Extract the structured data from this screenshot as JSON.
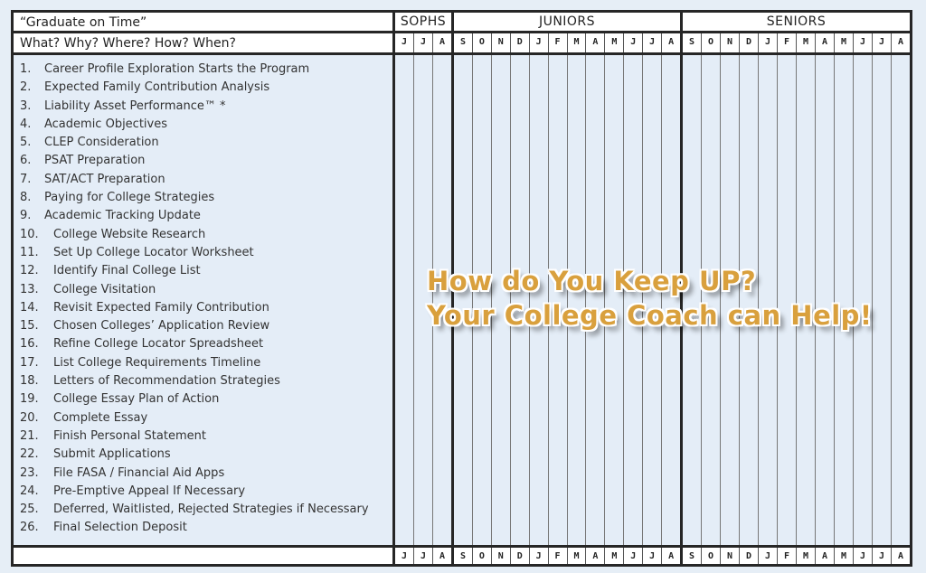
{
  "header": {
    "title": "“Graduate on Time”",
    "subtitle": "What? Why? Where? How? When?"
  },
  "sections": [
    {
      "label": "SOPHS",
      "months": [
        "J",
        "J",
        "A"
      ]
    },
    {
      "label": "JUNIORS",
      "months": [
        "S",
        "O",
        "N",
        "D",
        "J",
        "F",
        "M",
        "A",
        "M",
        "J",
        "J",
        "A"
      ]
    },
    {
      "label": "SENIORS",
      "months": [
        "S",
        "O",
        "N",
        "D",
        "J",
        "F",
        "M",
        "A",
        "M",
        "J",
        "J",
        "A"
      ]
    }
  ],
  "tasks": [
    {
      "num": "1.",
      "label": "Career Profile Exploration Starts the Program"
    },
    {
      "num": "2.",
      "label": "Expected Family Contribution Analysis"
    },
    {
      "num": "3.",
      "label": "Liability Asset Performance™ *"
    },
    {
      "num": "4.",
      "label": "Academic Objectives"
    },
    {
      "num": "5.",
      "label": "CLEP Consideration"
    },
    {
      "num": "6.",
      "label": "PSAT Preparation"
    },
    {
      "num": "7.",
      "label": "SAT/ACT Preparation"
    },
    {
      "num": "8.",
      "label": "Paying for College Strategies"
    },
    {
      "num": "9.",
      "label": "Academic Tracking Update"
    },
    {
      "num": "10.",
      "label": "College Website Research"
    },
    {
      "num": "11.",
      "label": "Set Up College Locator Worksheet"
    },
    {
      "num": "12.",
      "label": "Identify Final College List"
    },
    {
      "num": "13.",
      "label": "College Visitation"
    },
    {
      "num": "14.",
      "label": "Revisit Expected Family Contribution"
    },
    {
      "num": "15.",
      "label": "Chosen Colleges’ Application Review"
    },
    {
      "num": "16.",
      "label": "Refine College Locator Spreadsheet"
    },
    {
      "num": "17.",
      "label": "List College Requirements Timeline"
    },
    {
      "num": "18.",
      "label": "Letters of Recommendation Strategies"
    },
    {
      "num": "19.",
      "label": "College Essay Plan of Action"
    },
    {
      "num": "20.",
      "label": "Complete Essay"
    },
    {
      "num": "21.",
      "label": "Finish Personal Statement"
    },
    {
      "num": "22.",
      "label": "Submit Applications"
    },
    {
      "num": "23.",
      "label": "File FASA / Financial Aid Apps"
    },
    {
      "num": "24.",
      "label": "Pre-Emptive Appeal If Necessary"
    },
    {
      "num": "25.",
      "label": "Deferred, Waitlisted, Rejected Strategies if Necessary"
    },
    {
      "num": "26.",
      "label": "Final Selection Deposit"
    }
  ],
  "overlay": {
    "line1": "How do You Keep UP?",
    "line2": "Your College Coach can Help!",
    "color": "#d9a03d"
  }
}
